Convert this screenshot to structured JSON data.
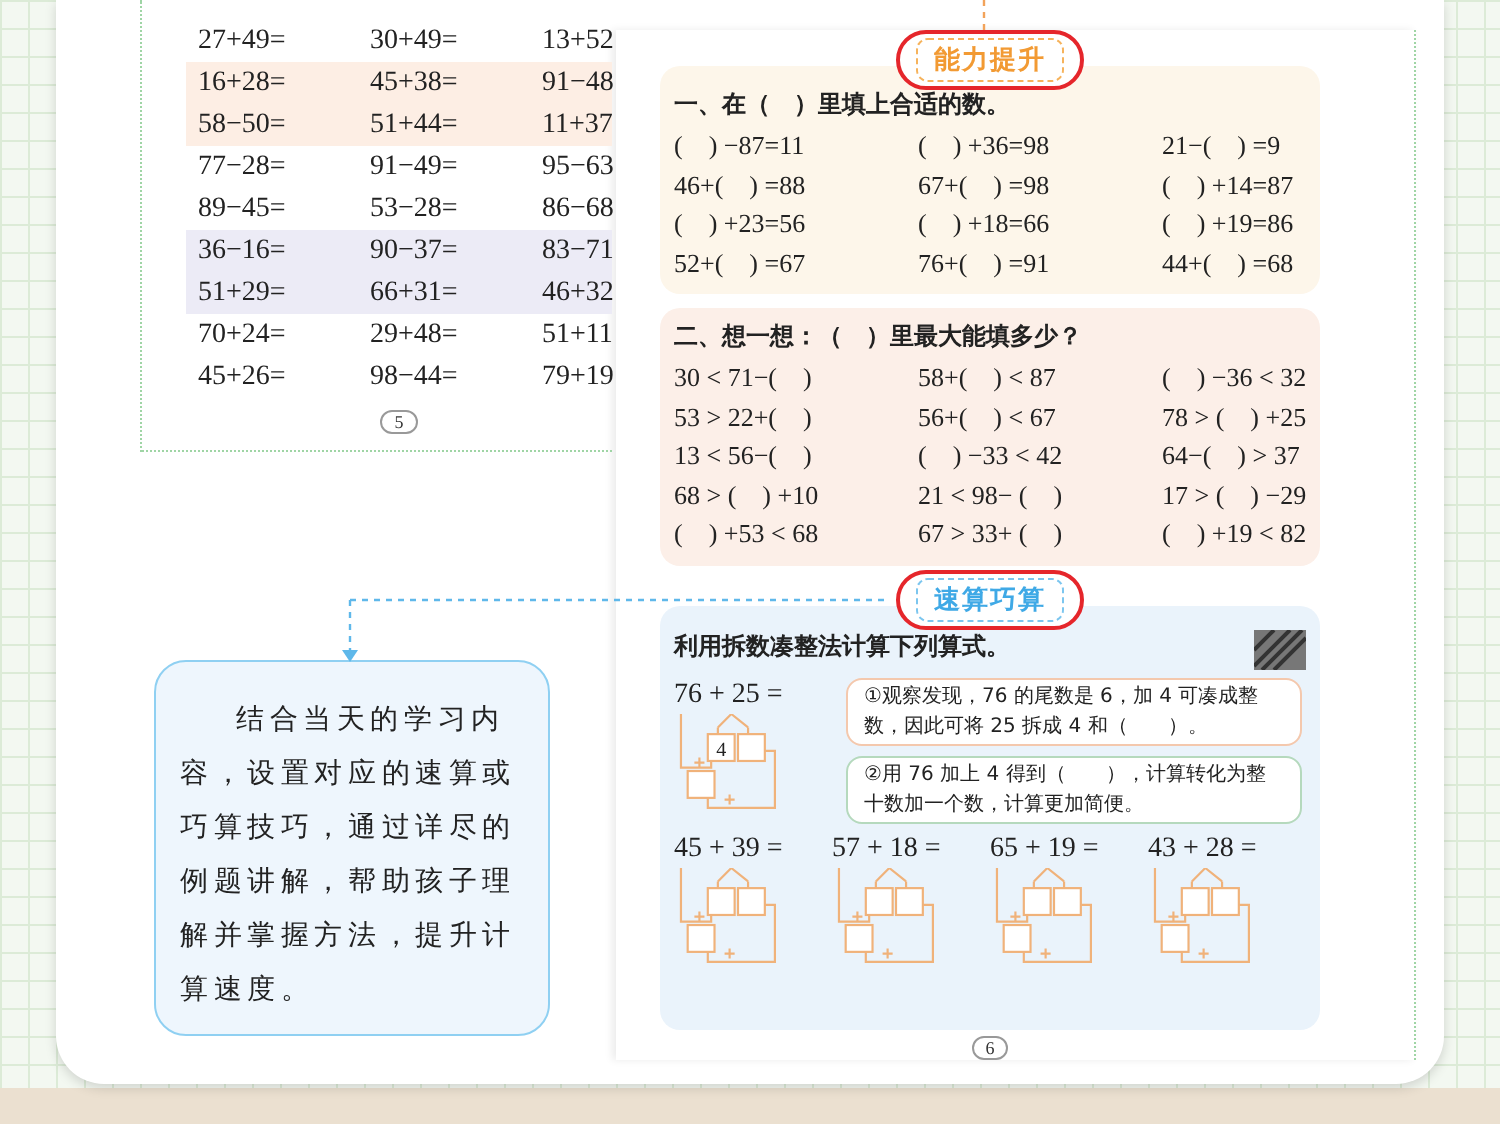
{
  "left_page": {
    "rows": [
      {
        "cells": [
          "27+49=",
          "30+49=",
          "13+52"
        ]
      },
      {
        "color": "#fdeee4",
        "cells": [
          "16+28=",
          "45+38=",
          "91−48"
        ]
      },
      {
        "color": "#fdeee4",
        "cells": [
          "58−50=",
          "51+44=",
          "11+37"
        ]
      },
      {
        "cells": [
          "77−28=",
          "91−49=",
          "95−63"
        ]
      },
      {
        "cells": [
          "89−45=",
          "53−28=",
          "86−68"
        ]
      },
      {
        "color": "#ecebf6",
        "cells": [
          "36−16=",
          "90−37=",
          "83−71"
        ]
      },
      {
        "color": "#ecebf6",
        "cells": [
          "51+29=",
          "66+31=",
          "46+32"
        ]
      },
      {
        "cells": [
          "70+24=",
          "29+48=",
          "51+11"
        ]
      },
      {
        "cells": [
          "45+26=",
          "98−44=",
          "79+19"
        ]
      }
    ],
    "page_number": "5"
  },
  "callout": {
    "text": "结合当天的学习内容，设置对应的速算或巧算技巧，通过详尽的例题讲解，帮助孩子理解并掌握方法，提升计算速度。"
  },
  "right_page": {
    "badge_1": {
      "label": "能力提升",
      "kind": "orange",
      "circled": true
    },
    "section_1": {
      "title": "一、在（　）里填上合适的数。",
      "rows": [
        [
          "(    ) −87=11",
          "(    ) +36=98",
          "21−(    ) =9"
        ],
        [
          "46+(    ) =88",
          "67+(    ) =98",
          "(    ) +14=87"
        ],
        [
          "(    ) +23=56",
          "(    ) +18=66",
          "(    ) +19=86"
        ],
        [
          "52+(    ) =67",
          "76+(    ) =91",
          "44+(    ) =68"
        ]
      ]
    },
    "section_2": {
      "title": "二、想一想：（　）里最大能填多少？",
      "rows": [
        [
          "30 < 71−(    )",
          "58+(    ) < 87",
          "(    ) −36 < 32"
        ],
        [
          "53 > 22+(    )",
          "56+(    ) < 67",
          "78 > (    ) +25"
        ],
        [
          "13 < 56−(    )",
          "(    ) −33 < 42",
          "64−(    ) > 37"
        ],
        [
          "68 > (    ) +10",
          "21 < 98− (    )",
          "17 > (    ) −29"
        ],
        [
          "(    ) +53 < 68",
          "67 > 33+ (    )",
          "(    ) +19 < 82"
        ]
      ]
    },
    "badge_2": {
      "label": "速算巧算",
      "kind": "blue",
      "circled": true
    },
    "section_3": {
      "title": "利用拆数凑整法计算下列算式。",
      "example": {
        "expression": "76 + 25 =",
        "split_number": "4",
        "steps": [
          "①观察发现，76 的尾数是 6，加 4 可凑成整数，因此可将 25 拆成 4 和（　　）。",
          "②用 76 加上 4 得到（　　），计算转化为整十数加一个数，计算更加简便。"
        ]
      },
      "exercises": [
        "45 + 39 =",
        "57 + 18 =",
        "65 + 19 =",
        "43 + 28 ="
      ]
    },
    "page_number": "6"
  }
}
